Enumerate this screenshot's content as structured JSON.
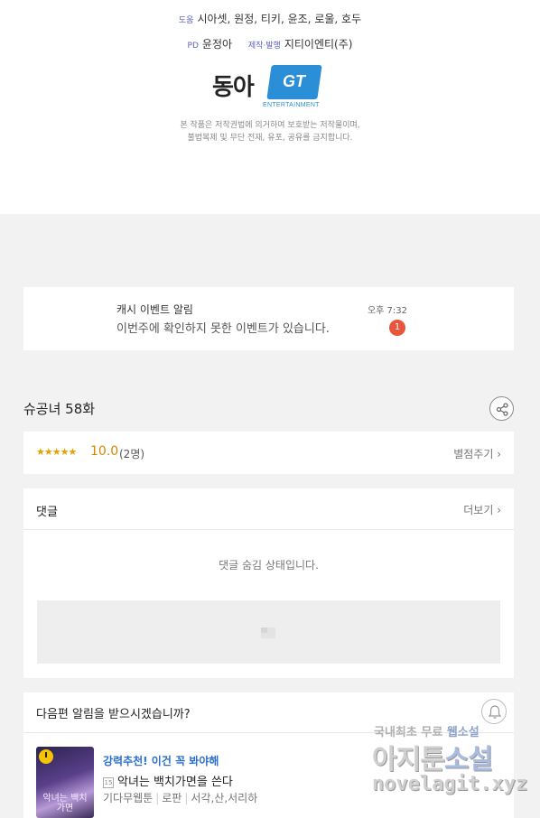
{
  "credits": {
    "assist_label": "도움",
    "assist_names": "시아셋, 원정, 티키, 윤조, 로울, 호두",
    "pd_label": "PD",
    "pd_name": "윤정아",
    "production_label": "제작·발행",
    "production_name": "지티이엔티(주)",
    "logo_donga": "동아",
    "logo_gt": "GT",
    "logo_gt_sub": "ENTERTAINMENT",
    "copyright_line1": "본 작품은 저작권법에 의거하여 보호받는 저작물이며,",
    "copyright_line2": "불법복제 및 무단 전재, 유포, 공유를 금지합니다."
  },
  "notice": {
    "title": "캐시 이벤트 알림",
    "message": "이번주에 확인하지 못한 이벤트가 있습니다.",
    "time": "오후 7:32",
    "badge": "1"
  },
  "episode": {
    "title": "슈공녀 58화",
    "share_icon": "share-icon"
  },
  "rating": {
    "stars": "★★★★★",
    "score": "10.0",
    "count": "(2명)",
    "rate_link": "별점주기 ›"
  },
  "comments": {
    "title": "댓글",
    "more_link": "더보기 ›",
    "hidden_message": "댓글 숨김 상태입니다."
  },
  "next_episode": {
    "title": "다음편 알림을 받으시겠습니까?",
    "bell_icon": "bell-icon"
  },
  "recommendation": {
    "label": "강력추천! 이건 꼭 봐야해",
    "tag": "15",
    "title": "악녀는 백치가면을 쓴다",
    "publisher": "기다무웹툰",
    "genre": "로판",
    "tags": "서각,산,서리하",
    "thumb_text": "악녀는 백치가면"
  },
  "watermark": {
    "top_prefix": "국내최초 무료 ",
    "top_highlight": "웹소설",
    "mid_prefix": "아지툰",
    "mid_highlight": "소설",
    "bottom": "novelagit.xyz"
  },
  "colors": {
    "accent_blue": "#2a6fd0",
    "badge_red": "#e8553b",
    "star_gold": "#e3a300",
    "background": "#f2f2f2"
  }
}
